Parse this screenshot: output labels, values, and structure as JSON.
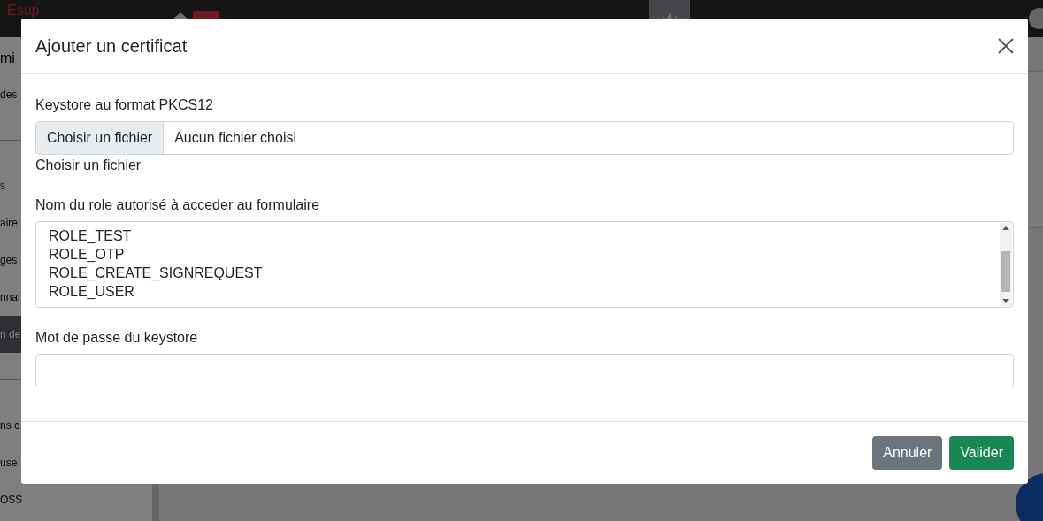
{
  "navbar": {
    "logo_top": "Esup"
  },
  "sidebar": {
    "heading": "mi",
    "items": [
      {
        "label": "des",
        "selected": false
      },
      {
        "label": "s",
        "selected": false
      },
      {
        "label": "aire",
        "selected": false
      },
      {
        "label": "ges",
        "selected": false
      },
      {
        "label": "nnai",
        "selected": false
      },
      {
        "label": "n de",
        "selected": true
      },
      {
        "label": "ns c",
        "selected": false
      },
      {
        "label": "use",
        "selected": false
      },
      {
        "label": "OSS",
        "selected": false
      }
    ]
  },
  "modal": {
    "title": "Ajouter un certificat",
    "keystore": {
      "label": "Keystore au format PKCS12",
      "button": "Choisir un fichier",
      "value": "Aucun fichier choisi",
      "help": "Choisir un fichier"
    },
    "roles": {
      "label": "Nom du role autorisé à acceder au formulaire",
      "options": [
        {
          "label": "ROLE_TEST",
          "selected": false
        },
        {
          "label": "ROLE_OTP",
          "selected": false
        },
        {
          "label": "ROLE_CREATE_SIGNREQUEST",
          "selected": false
        },
        {
          "label": "ROLE_USER",
          "selected": false
        }
      ]
    },
    "password": {
      "label": "Mot de passe du keystore"
    },
    "buttons": [
      {
        "kind": "secondary",
        "label": "Annuler"
      },
      {
        "kind": "primary",
        "label": "Valider"
      }
    ]
  }
}
